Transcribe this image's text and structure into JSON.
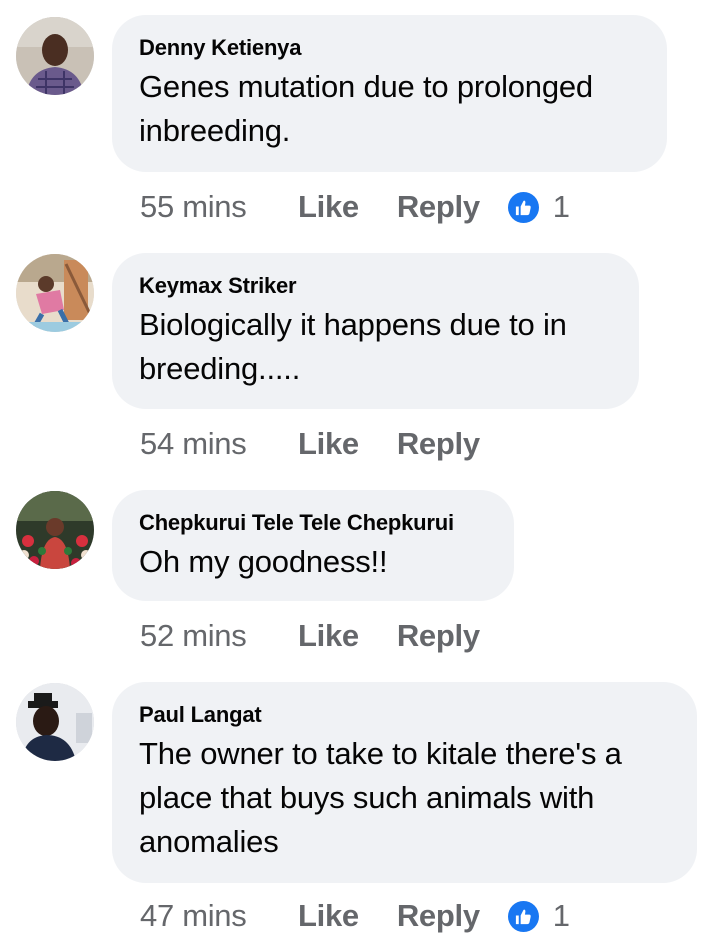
{
  "colors": {
    "bubble": "#f0f2f5",
    "text": "#050505",
    "meta": "#65676b",
    "like_blue": "#1877f2"
  },
  "comments": [
    {
      "author": "Denny Ketienya",
      "lines": [
        "Genes mutation due to prolonged",
        "inbreeding."
      ],
      "time": "55 mins",
      "like_label": "Like",
      "reply_label": "Reply",
      "reaction_icon": "thumbs-up-icon",
      "reaction_count": "1"
    },
    {
      "author": "Keymax Striker",
      "lines": [
        "Biologically it happens due to in",
        "breeding....."
      ],
      "time": "54 mins",
      "like_label": "Like",
      "reply_label": "Reply"
    },
    {
      "author": "Chepkurui Tele Tele Chepkurui",
      "lines": [
        "Oh my goodness!!"
      ],
      "time": "52 mins",
      "like_label": "Like",
      "reply_label": "Reply"
    },
    {
      "author": "Paul Langat",
      "lines": [
        "The owner to take to kitale there's a",
        "place that buys such animals with",
        "anomalies"
      ],
      "time": "47 mins",
      "like_label": "Like",
      "reply_label": "Reply",
      "reaction_icon": "thumbs-up-icon",
      "reaction_count": "1"
    }
  ]
}
